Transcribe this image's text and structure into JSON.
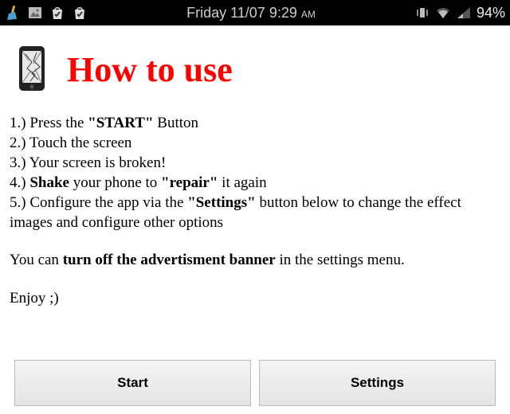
{
  "statusbar": {
    "datetime": "Friday 11/07 9:29",
    "ampm": "AM",
    "battery": "94%"
  },
  "title": "How to use",
  "instructions": {
    "l1_a": "1.) Press the ",
    "l1_b": "\"START\"",
    "l1_c": " Button",
    "l2": "2.) Touch the screen",
    "l3": "3.) Your screen is broken!",
    "l4_a": "4.) ",
    "l4_b": "Shake",
    "l4_c": " your phone to ",
    "l4_d": "\"repair\"",
    "l4_e": " it again",
    "l5_a": "5.) Configure the app via the ",
    "l5_b": "\"Settings\"",
    "l5_c": " button below to change the effect images and configure other options",
    "ad_a": "You can ",
    "ad_b": "turn off the advertisment banner",
    "ad_c": " in the settings menu.",
    "enjoy": "Enjoy ;)"
  },
  "buttons": {
    "start": "Start",
    "settings": "Settings"
  }
}
